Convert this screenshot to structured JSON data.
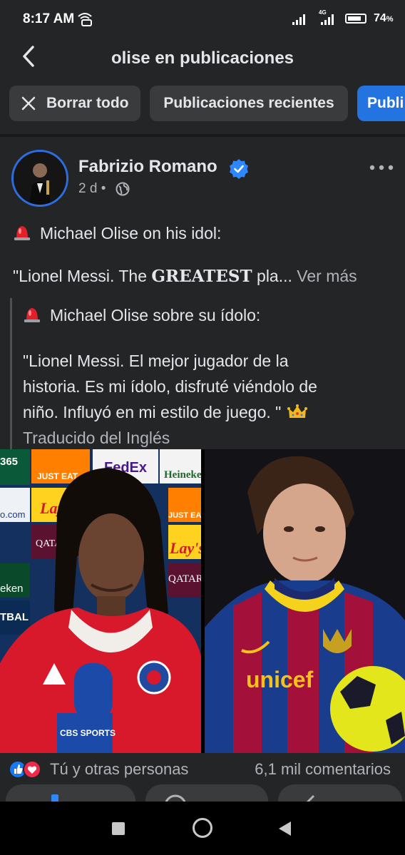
{
  "status_bar": {
    "time": "8:17 AM",
    "network": "4G",
    "battery": "74",
    "battery_unit": "%"
  },
  "header": {
    "title": "olise en publicaciones",
    "back_icon": "chevron-left-icon"
  },
  "filters": {
    "clear_label": "Borrar todo",
    "recent_label": "Publicaciones recientes",
    "active_label": "Publi"
  },
  "post": {
    "author": "Fabrizio Romano",
    "time": "2 d",
    "separator": "•",
    "line1": "Michael Olise on his idol:",
    "line2_start": "\"Lionel Messi. The ",
    "line2_bold": "GREATEST",
    "line2_end": " pla...",
    "see_more": "Ver más",
    "translation": {
      "line1": "Michael Olise sobre su ídolo:",
      "quote_line1": "\"Lionel Messi. El mejor jugador de la",
      "quote_line2": "historia. Es mi ídolo, disfruté viéndolo de",
      "quote_line3": "niño. Influyó en mi estilo de juego. \"",
      "source": "Traducido del Inglés"
    },
    "left_photo": {
      "ads": [
        "365",
        "JUST EAT",
        "FedEx",
        "Heineken",
        "Lay's",
        "JUST EAT",
        "QATAR AIRWAYS",
        "Lay's",
        "QATAR AIRWAYS",
        "o.com",
        "eken",
        "TBAL"
      ],
      "mic_label": "CBS SPORTS"
    },
    "right_photo": {
      "shirt_text": "unicef"
    },
    "reactions": {
      "who": "Tú y otras personas",
      "comments": "6,1 mil comentarios"
    }
  },
  "colors": {
    "background": "#242526",
    "chip": "#3a3b3c",
    "accent": "#2374e1"
  }
}
